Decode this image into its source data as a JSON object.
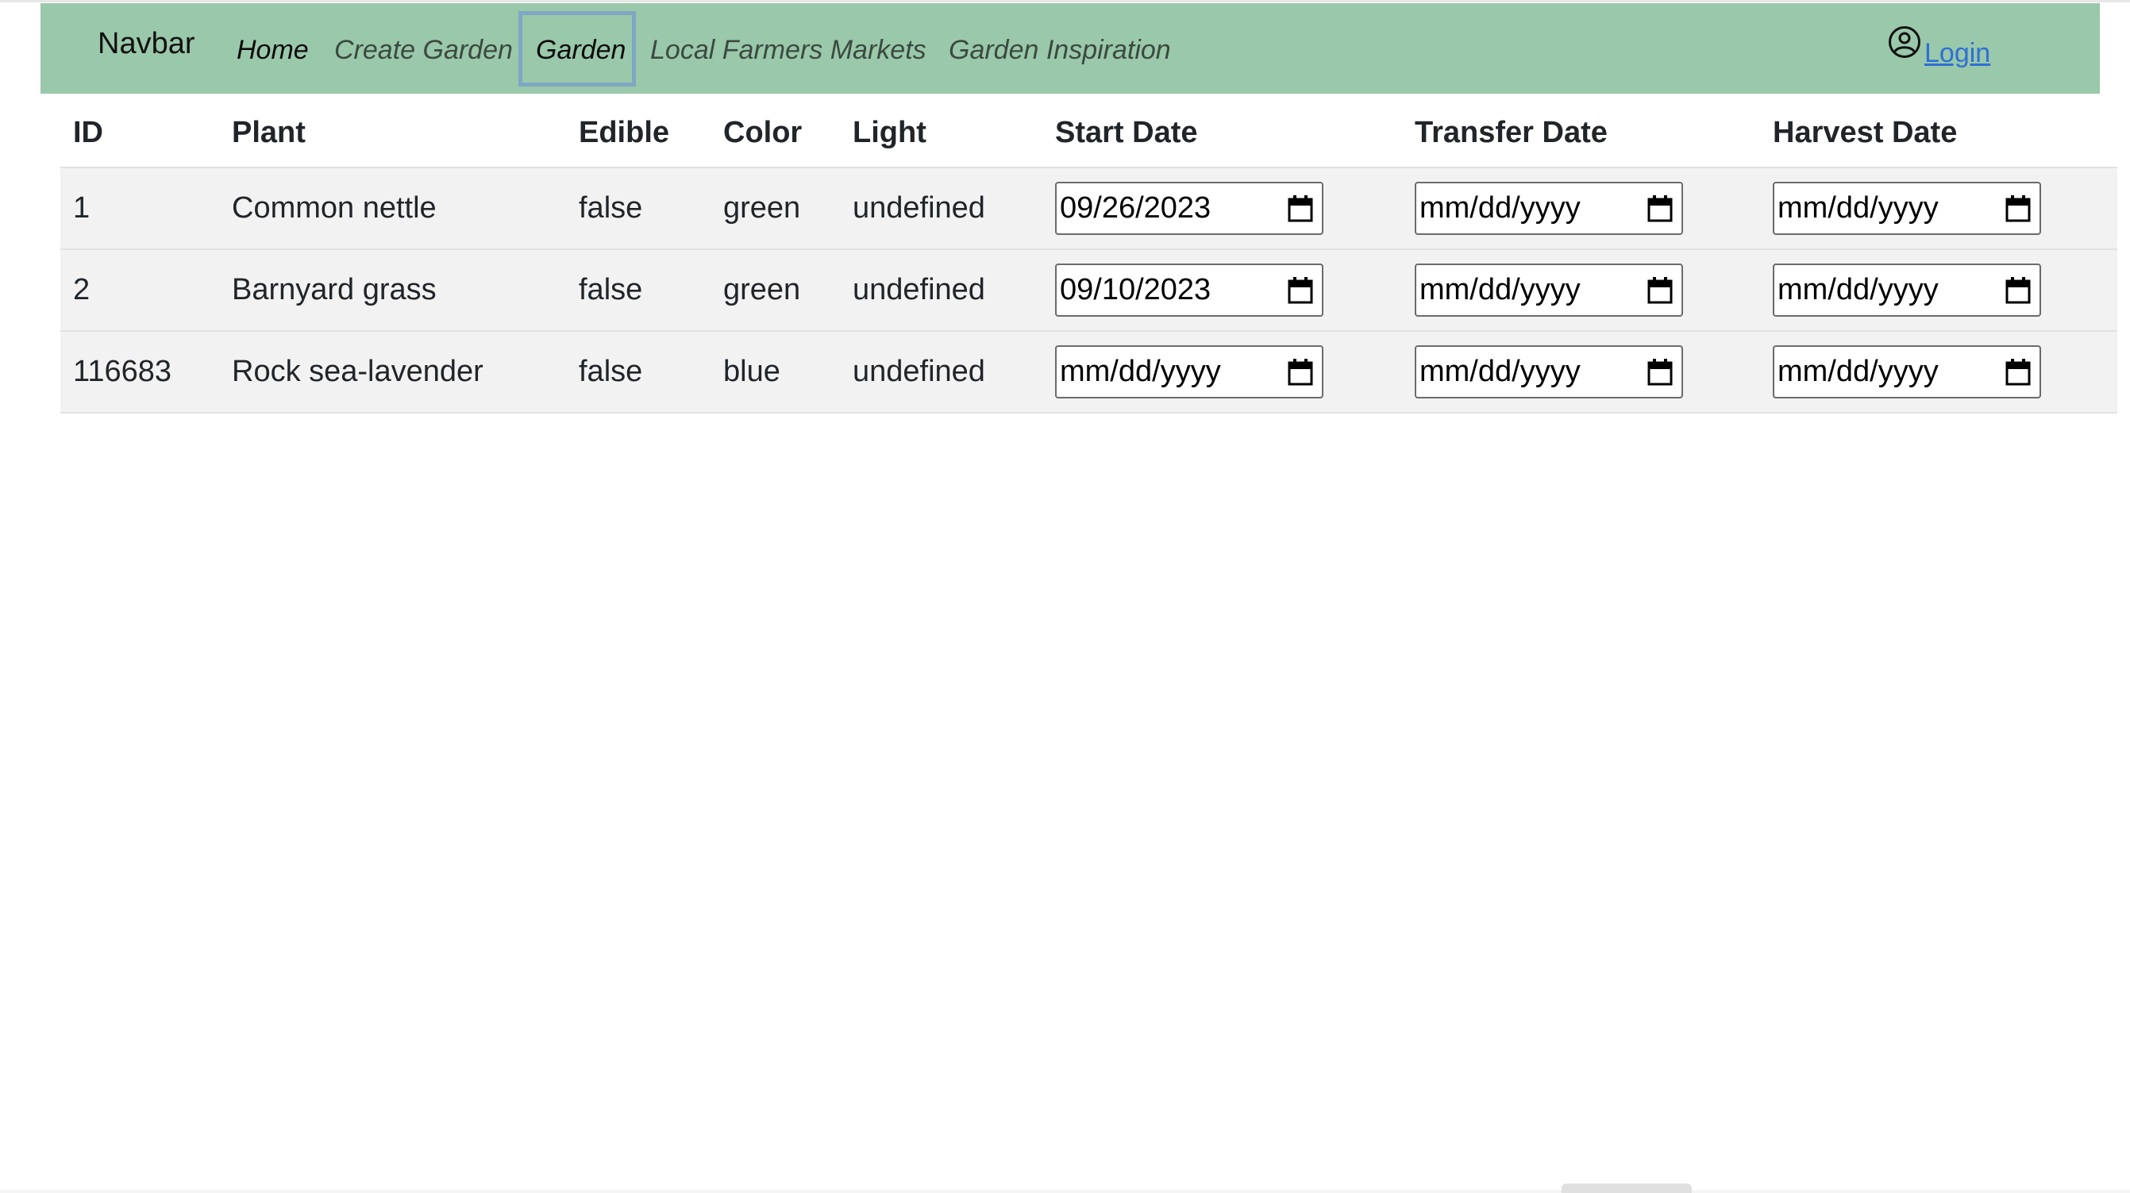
{
  "navbar": {
    "brand": "Navbar",
    "links": [
      {
        "label": "Home"
      },
      {
        "label": "Create Garden"
      },
      {
        "label": "Garden"
      },
      {
        "label": "Local Farmers Markets"
      },
      {
        "label": "Garden Inspiration"
      }
    ],
    "login_label": "Login",
    "user_icon": "user-circle-icon"
  },
  "table": {
    "headers": [
      "ID",
      "Plant",
      "Edible",
      "Color",
      "Light",
      "Start Date",
      "Transfer Date",
      "Harvest Date"
    ],
    "rows": [
      {
        "id": "1",
        "plant": "Common nettle",
        "edible": "false",
        "color": "green",
        "light": "undefined",
        "start": "09/26/2023",
        "transfer": "mm/dd/yyyy",
        "harvest": "mm/dd/yyyy"
      },
      {
        "id": "2",
        "plant": "Barnyard grass",
        "edible": "false",
        "color": "green",
        "light": "undefined",
        "start": "09/10/2023",
        "transfer": "mm/dd/yyyy",
        "harvest": "mm/dd/yyyy"
      },
      {
        "id": "116683",
        "plant": "Rock sea-lavender",
        "edible": "false",
        "color": "blue",
        "light": "undefined",
        "start": "mm/dd/yyyy",
        "transfer": "mm/dd/yyyy",
        "harvest": "mm/dd/yyyy"
      }
    ]
  },
  "colors": {
    "navbar_bg": "#9ac8aa",
    "row_bg": "#f2f2f2",
    "link_blue": "#2f6fd6",
    "focus_ring": "#7ea7c4"
  }
}
